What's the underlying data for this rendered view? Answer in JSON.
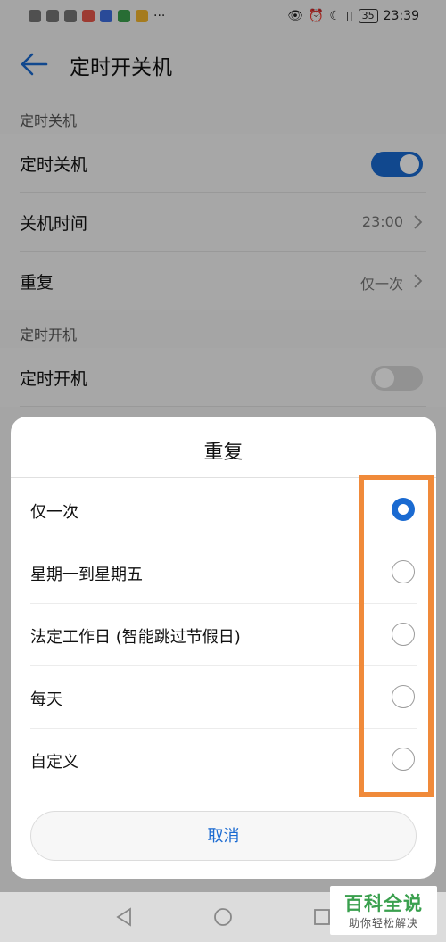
{
  "status": {
    "time": "23:39",
    "battery": "35",
    "more": "···"
  },
  "header": {
    "title": "定时开关机"
  },
  "shutdown": {
    "section_title": "定时关机",
    "toggle_label": "定时关机",
    "toggle_on": true,
    "time_label": "关机时间",
    "time_value": "23:00",
    "repeat_label": "重复",
    "repeat_value": "仅一次"
  },
  "boot": {
    "section_title": "定时开机",
    "toggle_label": "定时开机",
    "toggle_on": false
  },
  "dialog": {
    "title": "重复",
    "options": [
      {
        "label": "仅一次",
        "selected": true
      },
      {
        "label": "星期一到星期五",
        "selected": false
      },
      {
        "label": "法定工作日 (智能跳过节假日)",
        "selected": false
      },
      {
        "label": "每天",
        "selected": false
      },
      {
        "label": "自定义",
        "selected": false
      }
    ],
    "cancel_label": "取消"
  },
  "colors": {
    "accent": "#1a6ad1",
    "highlight": "#f08a3a",
    "watermark": "#3aa04e"
  },
  "watermark": {
    "main": "百科全说",
    "sub": "助你轻松解决"
  }
}
